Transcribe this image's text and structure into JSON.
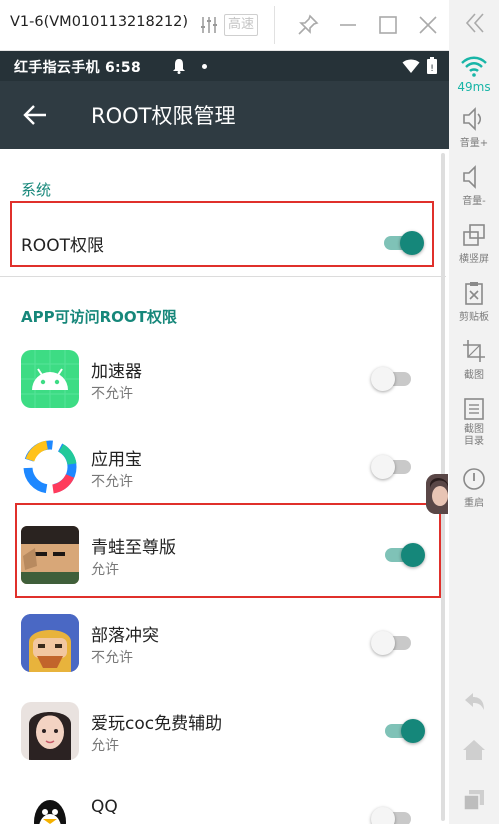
{
  "window": {
    "title": "V1-6(VM010113218212)",
    "speed_label": "高速"
  },
  "statusbar": {
    "text": "红手指云手机 6:58"
  },
  "appbar": {
    "title": "ROOT权限管理"
  },
  "sections": {
    "system": "系统",
    "app_access": "APP可访问ROOT权限"
  },
  "root_row": {
    "label": "ROOT权限",
    "enabled": true
  },
  "apps": [
    {
      "name": "加速器",
      "status": "不允许",
      "enabled": false,
      "icon": "android-robot-icon"
    },
    {
      "name": "应用宝",
      "status": "不允许",
      "enabled": false,
      "icon": "app-store-icon"
    },
    {
      "name": "青蛙至尊版",
      "status": "允许",
      "enabled": true,
      "icon": "anime-avatar-icon"
    },
    {
      "name": "部落冲突",
      "status": "不允许",
      "enabled": false,
      "icon": "barbarian-icon"
    },
    {
      "name": "爱玩coc免费辅助",
      "status": "允许",
      "enabled": true,
      "icon": "girl-avatar-icon"
    },
    {
      "name": "QQ",
      "status": "",
      "enabled": false,
      "icon": "penguin-icon"
    }
  ],
  "sidebar": {
    "ping": "49ms",
    "items": [
      {
        "label": "音量+",
        "icon": "volume-up-icon"
      },
      {
        "label": "音量-",
        "icon": "volume-down-icon"
      },
      {
        "label": "横竖屏",
        "icon": "rotate-screen-icon"
      },
      {
        "label": "剪贴板",
        "icon": "clipboard-icon"
      },
      {
        "label": "截图",
        "icon": "crop-icon"
      },
      {
        "label": "截图目录",
        "icon": "screenshot-folder-icon"
      },
      {
        "label": "重启",
        "icon": "power-icon"
      }
    ]
  },
  "colors": {
    "accent": "#15877a",
    "appbar": "#2f3b42",
    "statusbar": "#263238",
    "highlight": "#e0302b"
  }
}
